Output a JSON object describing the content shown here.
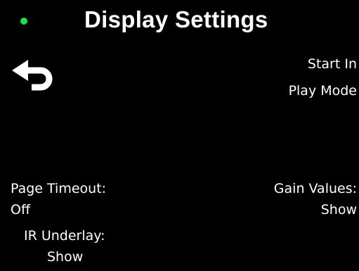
{
  "header": {
    "title": "Display Settings",
    "status_color": "#22dd44"
  },
  "back": {
    "icon": "back-arrow-icon"
  },
  "settings": {
    "start_in": {
      "label_line1": "Start In",
      "label_line2": "Play Mode"
    },
    "page_timeout": {
      "label": "Page Timeout:",
      "value": "Off"
    },
    "gain_values": {
      "label": "Gain Values:",
      "value": "Show"
    },
    "ir_underlay": {
      "label": "IR Underlay:",
      "value": "Show"
    }
  }
}
